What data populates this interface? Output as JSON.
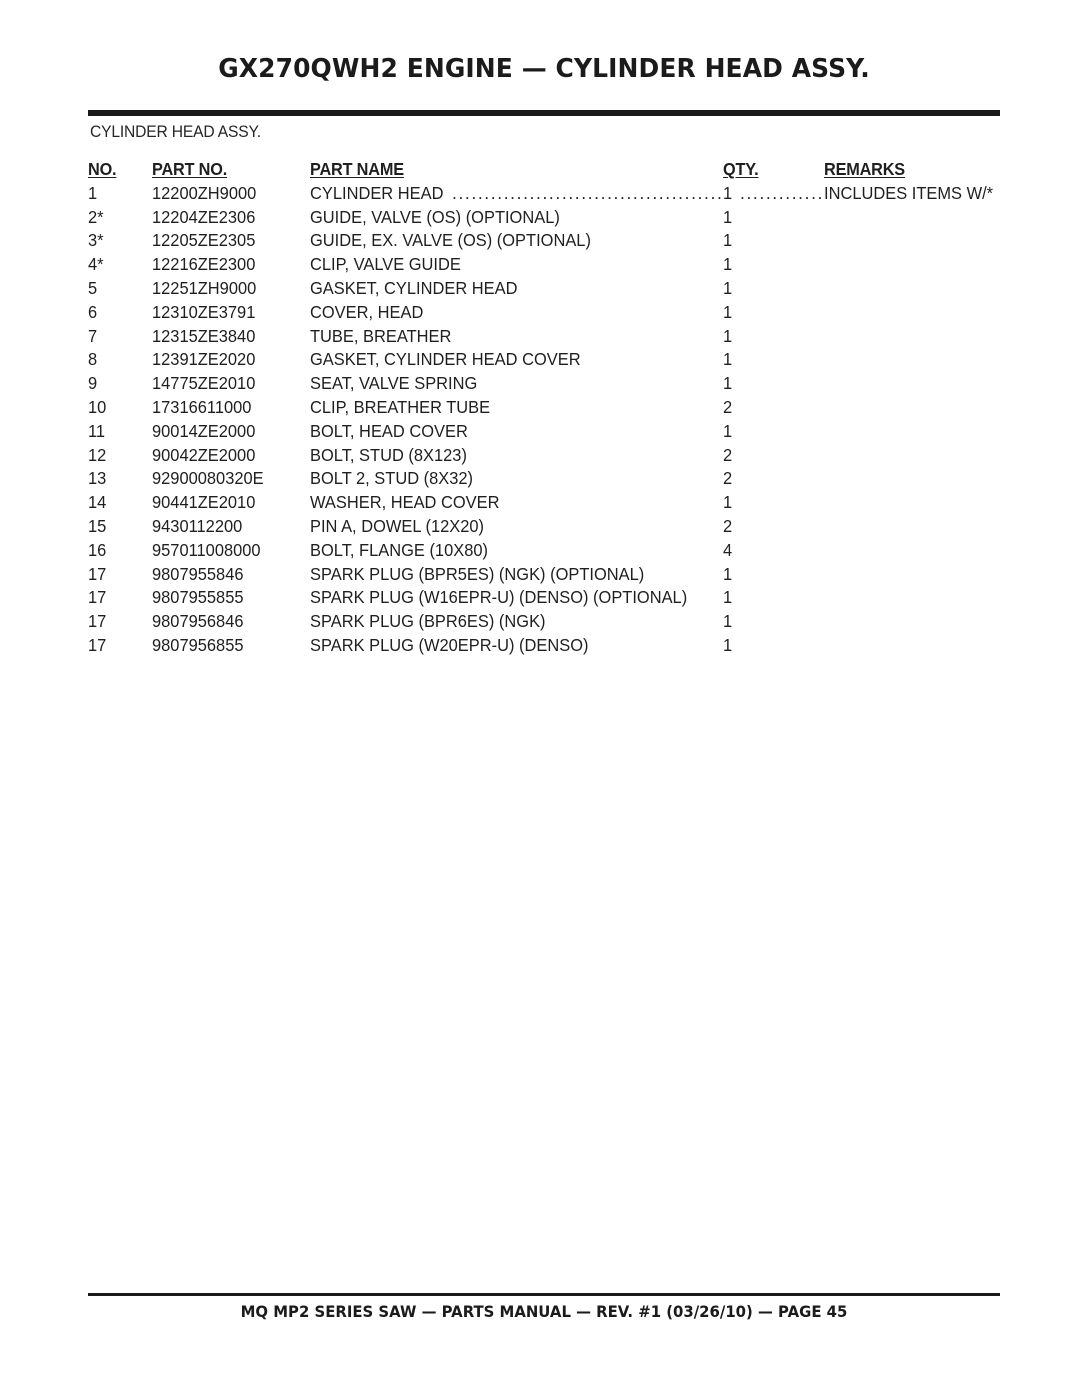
{
  "header": {
    "title": "GX270QWH2 ENGINE — CYLINDER HEAD ASSY.",
    "assembly_label": "CYLINDER HEAD ASSY."
  },
  "table": {
    "columns": {
      "no": "NO.",
      "part_no": "PART NO.",
      "part_name": "PART NAME",
      "qty": "QTY.",
      "remarks": "REMARKS"
    },
    "leader_a": "...........................................................",
    "leader_b": "..............",
    "rows": [
      {
        "no": "1",
        "part_no": "12200ZH9000",
        "part_name": "CYLINDER HEAD",
        "qty": "1",
        "remarks": "INCLUDES ITEMS W/*"
      },
      {
        "no": "2*",
        "part_no": "12204ZE2306",
        "part_name": "GUIDE, VALVE (OS) (OPTIONAL)",
        "qty": "1",
        "remarks": ""
      },
      {
        "no": "3*",
        "part_no": "12205ZE2305",
        "part_name": "GUIDE, EX. VALVE (OS) (OPTIONAL)",
        "qty": "1",
        "remarks": ""
      },
      {
        "no": "4*",
        "part_no": "12216ZE2300",
        "part_name": "CLIP, VALVE GUIDE",
        "qty": "1",
        "remarks": ""
      },
      {
        "no": "5",
        "part_no": "12251ZH9000",
        "part_name": "GASKET, CYLINDER HEAD",
        "qty": "1",
        "remarks": ""
      },
      {
        "no": "6",
        "part_no": "12310ZE3791",
        "part_name": "COVER, HEAD",
        "qty": "1",
        "remarks": ""
      },
      {
        "no": "7",
        "part_no": "12315ZE3840",
        "part_name": "TUBE, BREATHER",
        "qty": "1",
        "remarks": ""
      },
      {
        "no": "8",
        "part_no": "12391ZE2020",
        "part_name": "GASKET, CYLINDER HEAD COVER",
        "qty": "1",
        "remarks": ""
      },
      {
        "no": "9",
        "part_no": "14775ZE2010",
        "part_name": "SEAT, VALVE SPRING",
        "qty": "1",
        "remarks": ""
      },
      {
        "no": "10",
        "part_no": "17316611000",
        "part_name": "CLIP, BREATHER TUBE",
        "qty": "2",
        "remarks": ""
      },
      {
        "no": "11",
        "part_no": "90014ZE2000",
        "part_name": "BOLT, HEAD COVER",
        "qty": "1",
        "remarks": ""
      },
      {
        "no": "12",
        "part_no": "90042ZE2000",
        "part_name": "BOLT, STUD (8X123)",
        "qty": "2",
        "remarks": ""
      },
      {
        "no": "13",
        "part_no": "92900080320E",
        "part_name": "BOLT 2, STUD (8X32)",
        "qty": "2",
        "remarks": ""
      },
      {
        "no": "14",
        "part_no": "90441ZE2010",
        "part_name": "WASHER, HEAD COVER",
        "qty": "1",
        "remarks": ""
      },
      {
        "no": "15",
        "part_no": "9430112200",
        "part_name": "PIN A, DOWEL (12X20)",
        "qty": "2",
        "remarks": ""
      },
      {
        "no": "16",
        "part_no": "957011008000",
        "part_name": "BOLT, FLANGE (10X80)",
        "qty": "4",
        "remarks": ""
      },
      {
        "no": "17",
        "part_no": "9807955846",
        "part_name": "SPARK PLUG (BPR5ES) (NGK) (OPTIONAL)",
        "qty": "1",
        "remarks": ""
      },
      {
        "no": "17",
        "part_no": "9807955855",
        "part_name": "SPARK PLUG (W16EPR-U) (DENSO) (OPTIONAL)",
        "qty": "1",
        "remarks": ""
      },
      {
        "no": "17",
        "part_no": "9807956846",
        "part_name": "SPARK PLUG (BPR6ES) (NGK)",
        "qty": "1",
        "remarks": ""
      },
      {
        "no": "17",
        "part_no": "9807956855",
        "part_name": "SPARK PLUG (W20EPR-U) (DENSO)",
        "qty": "1",
        "remarks": ""
      }
    ]
  },
  "footer": {
    "text": "MQ MP2 SERIES SAW — PARTS MANUAL — REV. #1  (03/26/10) — PAGE 45"
  },
  "colors": {
    "ink": "#1a1a1a",
    "paper": "#ffffff"
  }
}
